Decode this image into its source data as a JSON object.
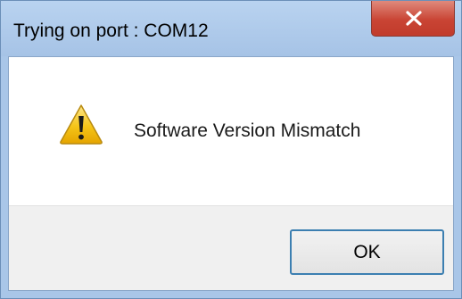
{
  "window": {
    "title": "Trying on port : COM12",
    "close_icon": "close-icon"
  },
  "dialog": {
    "icon": "warning-icon",
    "message": "Software Version Mismatch"
  },
  "buttons": {
    "ok_label": "OK"
  },
  "colors": {
    "titlebar": "#a9c6e8",
    "close_button": "#c94434",
    "button_area": "#f0f0f0",
    "ok_border": "#3c7fb1",
    "warning_fill": "#f5c518"
  }
}
